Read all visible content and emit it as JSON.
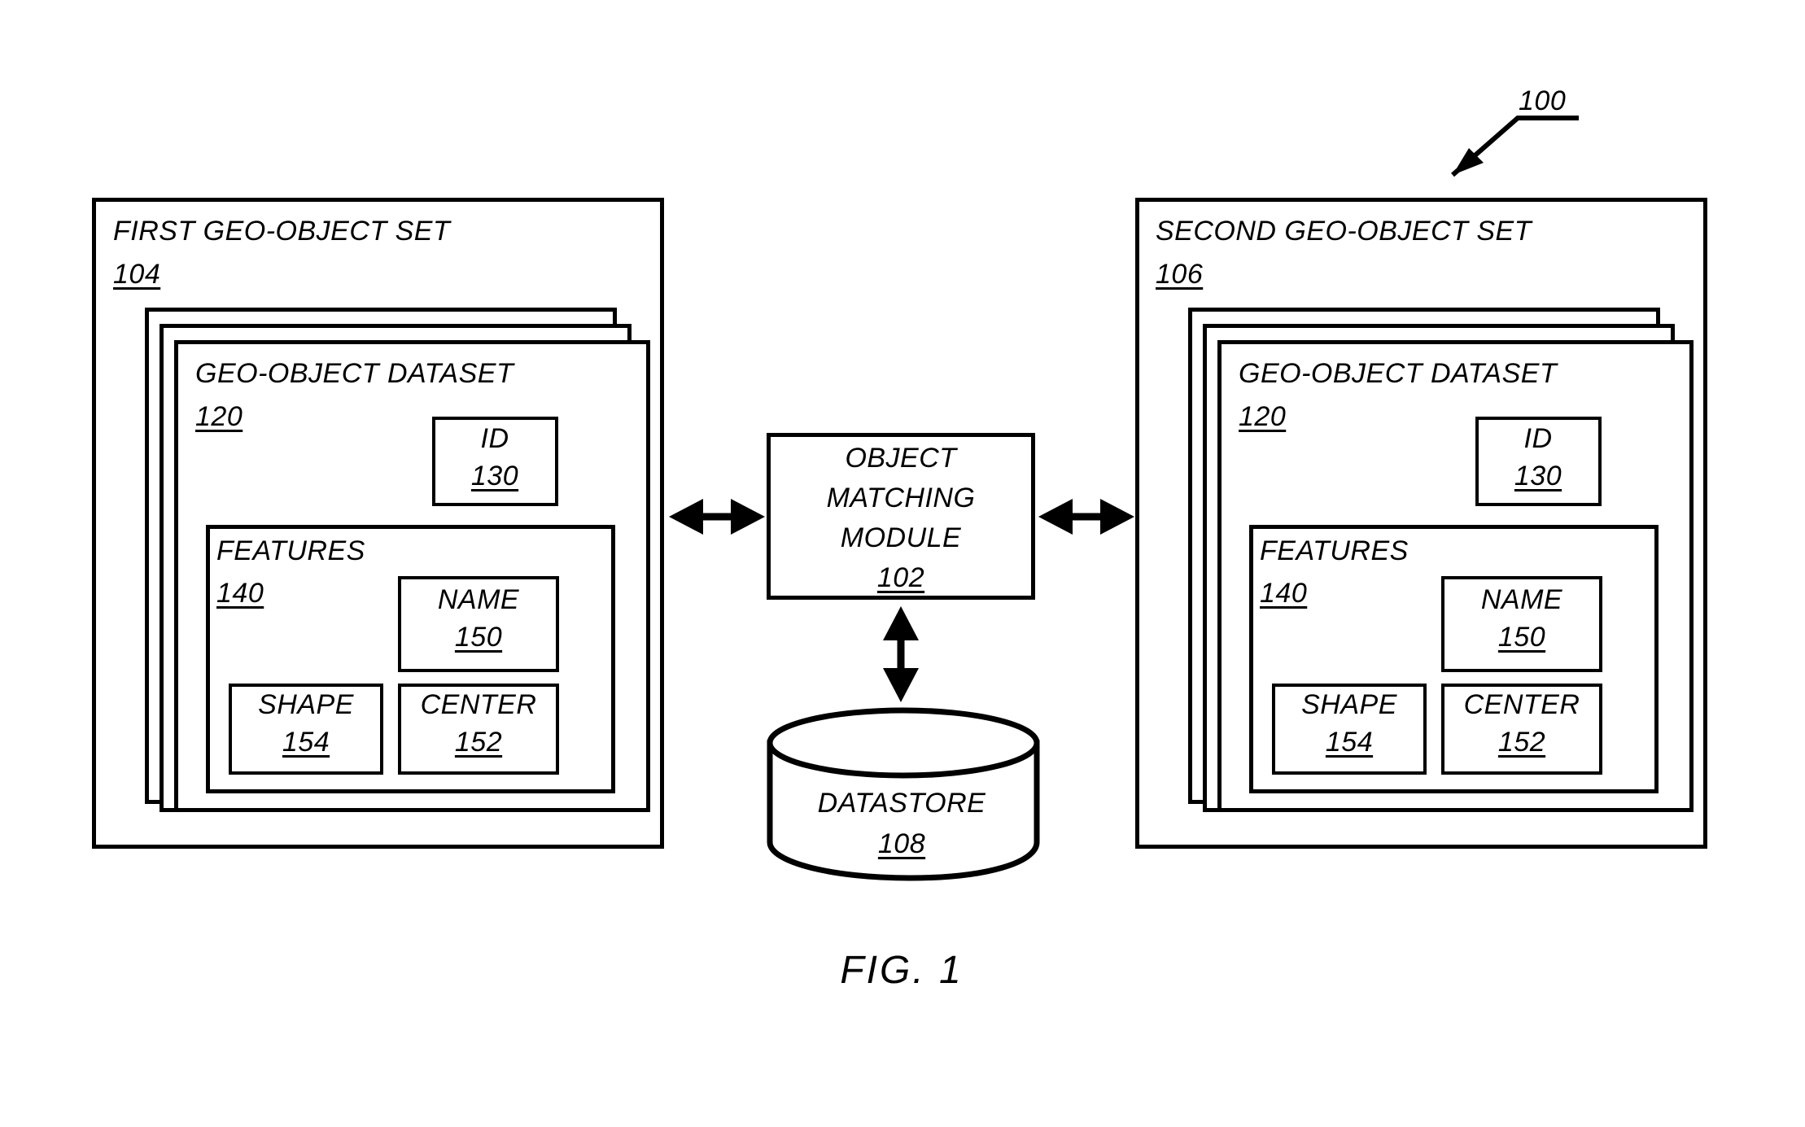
{
  "figure": {
    "caption": "FIG. 1",
    "system_label": "100"
  },
  "left_set": {
    "title": "FIRST GEO-OBJECT SET",
    "ref": "104",
    "dataset": {
      "title": "GEO-OBJECT DATASET",
      "ref": "120",
      "id_box": {
        "title": "ID",
        "ref": "130"
      },
      "features": {
        "title": "FEATURES",
        "ref": "140",
        "name_box": {
          "title": "NAME",
          "ref": "150"
        },
        "shape_box": {
          "title": "SHAPE",
          "ref": "154"
        },
        "center_box": {
          "title": "CENTER",
          "ref": "152"
        }
      }
    }
  },
  "right_set": {
    "title": "SECOND GEO-OBJECT SET",
    "ref": "106",
    "dataset": {
      "title": "GEO-OBJECT DATASET",
      "ref": "120",
      "id_box": {
        "title": "ID",
        "ref": "130"
      },
      "features": {
        "title": "FEATURES",
        "ref": "140",
        "name_box": {
          "title": "NAME",
          "ref": "150"
        },
        "shape_box": {
          "title": "SHAPE",
          "ref": "154"
        },
        "center_box": {
          "title": "CENTER",
          "ref": "152"
        }
      }
    }
  },
  "module": {
    "line1": "OBJECT",
    "line2": "MATCHING",
    "line3": "MODULE",
    "ref": "102"
  },
  "datastore": {
    "title": "DATASTORE",
    "ref": "108"
  },
  "colors": {
    "stroke": "#000000",
    "background": "#ffffff"
  }
}
